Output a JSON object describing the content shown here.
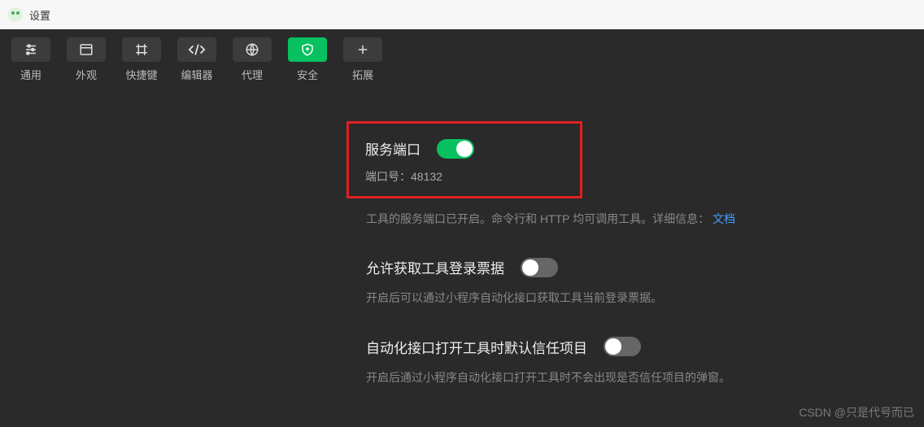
{
  "titlebar": {
    "title": "设置"
  },
  "tabs": [
    {
      "id": "general",
      "label": "通用"
    },
    {
      "id": "appearance",
      "label": "外观"
    },
    {
      "id": "shortcut",
      "label": "快捷键"
    },
    {
      "id": "editor",
      "label": "编辑器"
    },
    {
      "id": "proxy",
      "label": "代理"
    },
    {
      "id": "security",
      "label": "安全"
    },
    {
      "id": "extensions",
      "label": "拓展"
    }
  ],
  "port": {
    "title": "服务端口",
    "port_label": "端口号：",
    "port_value": "48132",
    "desc_prefix": "工具的服务端口已开启。命令行和 HTTP 均可调用工具。详细信息：",
    "doc_link": "文档"
  },
  "ticket": {
    "title": "允许获取工具登录票据",
    "desc": "开启后可以通过小程序自动化接口获取工具当前登录票据。"
  },
  "autotrust": {
    "title": "自动化接口打开工具时默认信任项目",
    "desc": "开启后通过小程序自动化接口打开工具时不会出现是否信任项目的弹窗。"
  },
  "watermark": "CSDN @只是代号而已"
}
